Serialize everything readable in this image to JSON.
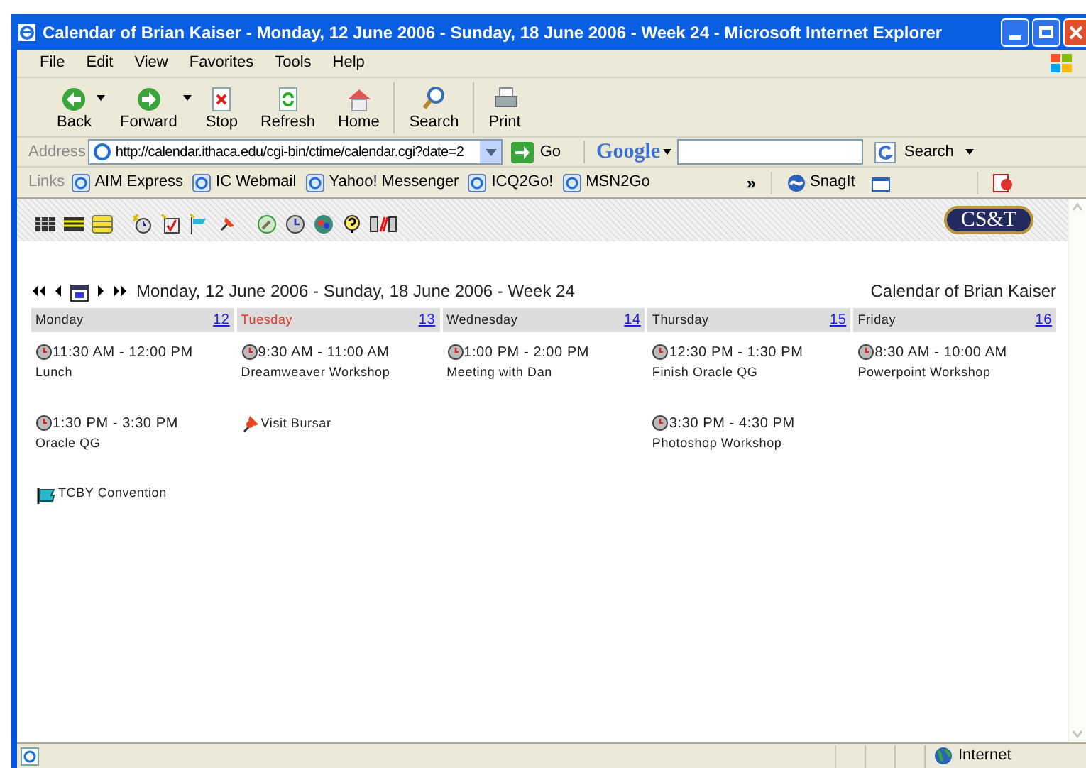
{
  "window": {
    "title": "Calendar of Brian Kaiser - Monday, 12 June 2006 - Sunday, 18 June 2006 - Week 24 - Microsoft Internet Explorer"
  },
  "menu": [
    "File",
    "Edit",
    "View",
    "Favorites",
    "Tools",
    "Help"
  ],
  "toolbar": [
    {
      "label": "Back",
      "kind": "back",
      "dropdown": true
    },
    {
      "label": "Forward",
      "kind": "forward",
      "dropdown": true
    },
    {
      "label": "Stop",
      "kind": "stop",
      "dropdown": false
    },
    {
      "label": "Refresh",
      "kind": "refresh",
      "dropdown": false
    },
    {
      "label": "Home",
      "kind": "home",
      "dropdown": false
    },
    {
      "label": "Search",
      "kind": "search",
      "dropdown": false
    },
    {
      "label": "Print",
      "kind": "print",
      "dropdown": false
    }
  ],
  "address": {
    "label": "Address",
    "value": "http://calendar.ithaca.edu/cgi-bin/ctime/calendar.cgi?date=2",
    "go": "Go"
  },
  "google": {
    "logo": "Google",
    "search": "Search"
  },
  "links": {
    "label": "Links",
    "items": [
      "AIM Express",
      "IC Webmail",
      "Yahoo! Messenger",
      "ICQ2Go!",
      "MSN2Go"
    ],
    "chevron": "»",
    "snagit": "SnagIt"
  },
  "calendar": {
    "logo": "CS&T",
    "range": "Monday, 12 June 2006 - Sunday, 18 June 2006 - Week 24",
    "owner": "Calendar of Brian Kaiser",
    "days": [
      {
        "name": "Monday",
        "date": "12",
        "selected": false,
        "events": [
          {
            "kind": "timed",
            "time": "11:30 AM - 12:00 PM",
            "title": "Lunch"
          },
          {
            "kind": "timed",
            "time": "1:30 PM - 3:30 PM",
            "title": "Oracle QG"
          },
          {
            "kind": "flag",
            "title": "TCBY Convention"
          }
        ]
      },
      {
        "name": "Tuesday",
        "date": "13",
        "selected": true,
        "events": [
          {
            "kind": "timed",
            "time": "9:30 AM - 11:00 AM",
            "title": "Dreamweaver Workshop"
          },
          {
            "kind": "pin",
            "title": "Visit Bursar"
          }
        ]
      },
      {
        "name": "Wednesday",
        "date": "14",
        "selected": false,
        "events": [
          {
            "kind": "timed",
            "time": "1:00 PM - 2:00 PM",
            "title": "Meeting with Dan"
          }
        ]
      },
      {
        "name": "Thursday",
        "date": "15",
        "selected": false,
        "events": [
          {
            "kind": "timed",
            "time": "12:30 PM - 1:30 PM",
            "title": "Finish Oracle QG"
          },
          {
            "kind": "timed",
            "time": "3:30 PM - 4:30 PM",
            "title": "Photoshop Workshop"
          }
        ]
      },
      {
        "name": "Friday",
        "date": "16",
        "selected": false,
        "events": [
          {
            "kind": "timed",
            "time": "8:30 AM - 10:00 AM",
            "title": "Powerpoint Workshop"
          }
        ]
      }
    ]
  },
  "status_bar": {
    "zone": "Internet"
  }
}
